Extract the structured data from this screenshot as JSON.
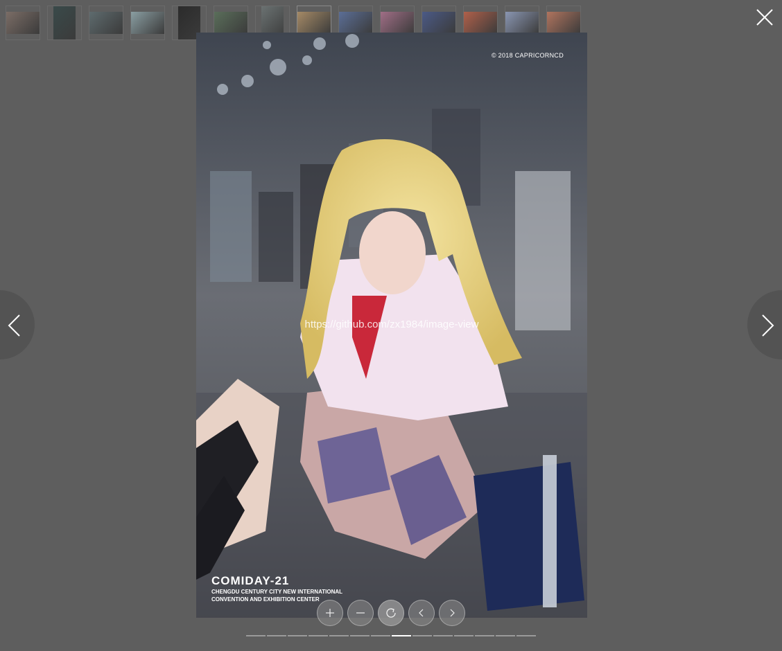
{
  "viewer": {
    "watermark": "https://github.com/zx1984/image-view",
    "current_index": 8,
    "total_images": 14
  },
  "image": {
    "copyright": "© 2018 CAPRICORNCD",
    "event_title": "COMIDAY-21",
    "event_subtitle_line1": "CHENGDU CENTURY CITY NEW INTERNATIONAL",
    "event_subtitle_line2": "CONVENTION AND EXHIBITION CENTER"
  },
  "thumbnails": [
    {
      "color": "#7b6d66",
      "orientation": "landscape"
    },
    {
      "color": "#3a4a4a",
      "orientation": "portrait"
    },
    {
      "color": "#5e6b6e",
      "orientation": "landscape"
    },
    {
      "color": "#8a9ea2",
      "orientation": "landscape"
    },
    {
      "color": "#2b2b2b",
      "orientation": "portrait"
    },
    {
      "color": "#5a6e5a",
      "orientation": "landscape"
    },
    {
      "color": "#6b7272",
      "orientation": "portrait"
    },
    {
      "color": "#a58a66",
      "orientation": "landscape"
    },
    {
      "color": "#5b6e96",
      "orientation": "landscape"
    },
    {
      "color": "#a06e86",
      "orientation": "landscape"
    },
    {
      "color": "#4b5a86",
      "orientation": "landscape"
    },
    {
      "color": "#b0604a",
      "orientation": "landscape"
    },
    {
      "color": "#8a96b2",
      "orientation": "landscape"
    },
    {
      "color": "#b0745e",
      "orientation": "landscape"
    }
  ],
  "icons": {
    "close": "close-icon",
    "prev": "chevron-left-icon",
    "next": "chevron-right-icon",
    "zoom_in": "plus-icon",
    "zoom_out": "minus-icon",
    "rotate": "rotate-icon"
  }
}
